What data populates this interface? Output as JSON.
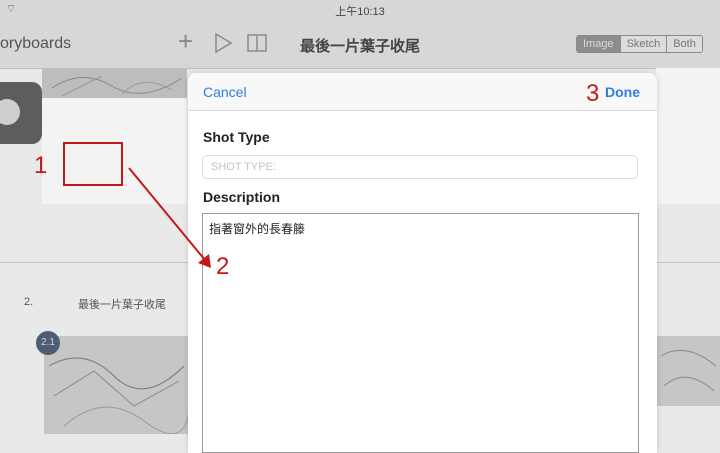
{
  "status_bar": {
    "time": "上午10:13",
    "wifi_icon": "wifi-icon"
  },
  "nav": {
    "back_label": "oryboards",
    "title": "最後一片葉子收尾",
    "icons": [
      "plus-icon",
      "play-icon",
      "book-icon"
    ],
    "segments": [
      "Image",
      "Sketch",
      "Both"
    ],
    "selected_segment": "Image"
  },
  "background": {
    "section_number": "2.",
    "section_title": "最後一片葉子收尾",
    "shot_badge": "2.1"
  },
  "modal": {
    "cancel_label": "Cancel",
    "done_label": "Done",
    "shot_type_label": "Shot Type",
    "shot_type_placeholder": "SHOT TYPE:",
    "shot_type_value": "",
    "description_label": "Description",
    "description_value": "指著窗外的長春籐"
  },
  "annotations": {
    "num1": "1",
    "num2": "2",
    "num3": "3",
    "color": "#c21a1a"
  },
  "colors": {
    "accent": "#2f7de1",
    "annotation": "#c21a1a"
  }
}
